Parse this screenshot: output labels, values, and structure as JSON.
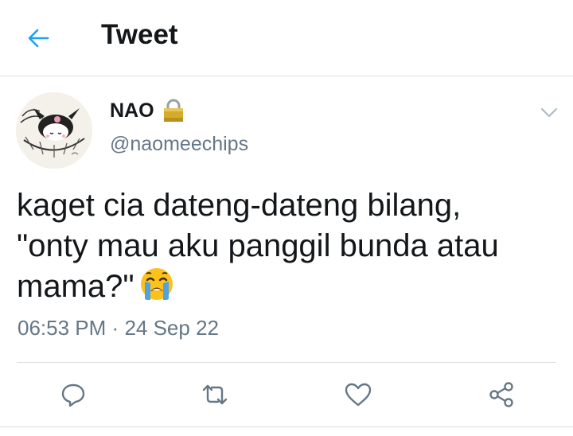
{
  "header": {
    "title": "Tweet",
    "back_icon": "arrow-left-icon",
    "accent": "#1da1f2"
  },
  "tweet": {
    "author": {
      "name": "NAO",
      "handle": "@naomeechips",
      "protected_icon": "lock-icon"
    },
    "text_lines": [
      "kaget cia dateng-dateng bilang,",
      "\"onty mau aku panggil bunda atau",
      "mama?\""
    ],
    "emoji": "loudly-crying-face",
    "time": "06:53 PM",
    "separator": "·",
    "date": "24 Sep 22"
  },
  "actions": [
    "reply-icon",
    "retweet-icon",
    "like-icon",
    "share-icon"
  ],
  "colors": {
    "text": "#14171a",
    "secondary": "#657786",
    "divider": "#dcdfe3"
  }
}
